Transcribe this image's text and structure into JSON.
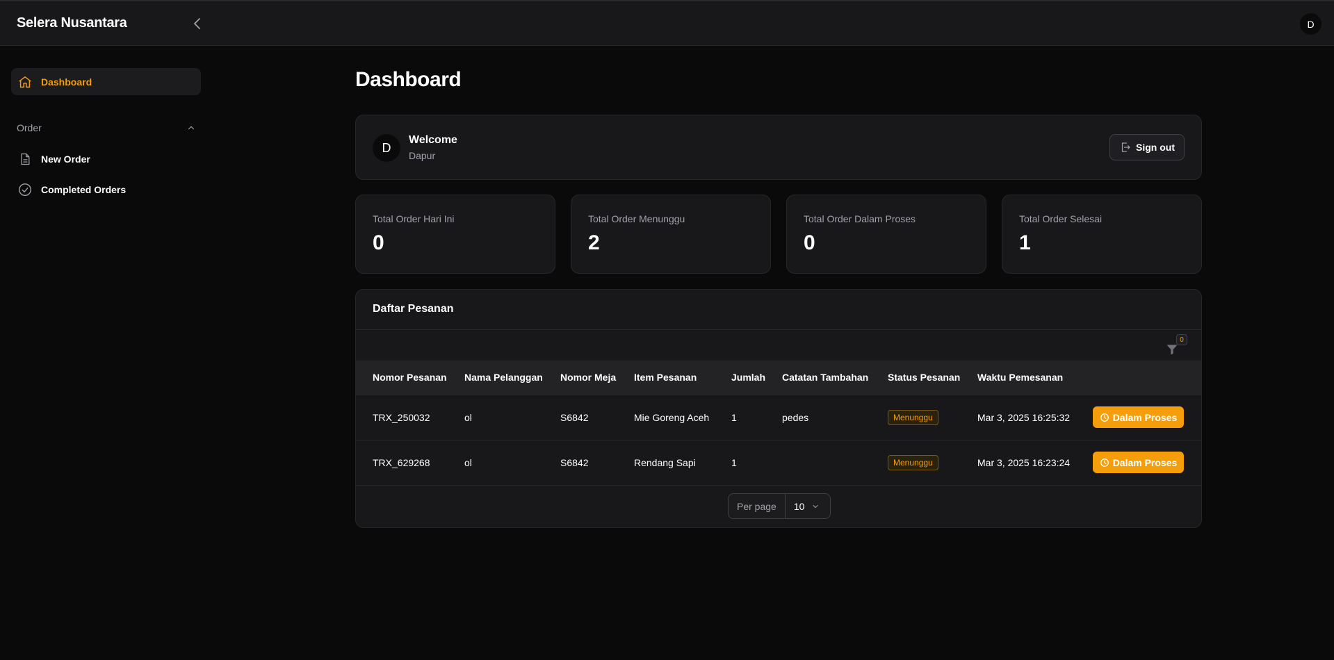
{
  "app": {
    "brand": "Selera Nusantara",
    "user_initial": "D"
  },
  "sidebar": {
    "items": [
      {
        "label": "Dashboard",
        "icon": "home-icon"
      }
    ],
    "section": {
      "label": "Order"
    },
    "order_items": [
      {
        "label": "New Order",
        "icon": "document-icon"
      },
      {
        "label": "Completed Orders",
        "icon": "check-circle-icon"
      }
    ]
  },
  "page": {
    "title": "Dashboard"
  },
  "welcome": {
    "initial": "D",
    "title": "Welcome",
    "subtitle": "Dapur",
    "signout_label": "Sign out"
  },
  "stats": [
    {
      "label": "Total Order Hari Ini",
      "value": "0"
    },
    {
      "label": "Total Order Menunggu",
      "value": "2"
    },
    {
      "label": "Total Order Dalam Proses",
      "value": "0"
    },
    {
      "label": "Total Order Selesai",
      "value": "1"
    }
  ],
  "orders": {
    "title": "Daftar Pesanan",
    "filter_count": "0",
    "columns": [
      "Nomor Pesanan",
      "Nama Pelanggan",
      "Nomor Meja",
      "Item Pesanan",
      "Jumlah",
      "Catatan Tambahan",
      "Status Pesanan",
      "Waktu Pemesanan"
    ],
    "rows": [
      {
        "nomor": "TRX_250032",
        "nama": "ol",
        "meja": "S6842",
        "item": "Mie Goreng Aceh",
        "jumlah": "1",
        "catatan": "pedes",
        "status": "Menunggu",
        "waktu": "Mar 3, 2025 16:25:32",
        "action": "Dalam Proses"
      },
      {
        "nomor": "TRX_629268",
        "nama": "ol",
        "meja": "S6842",
        "item": "Rendang Sapi",
        "jumlah": "1",
        "catatan": "",
        "status": "Menunggu",
        "waktu": "Mar 3, 2025 16:23:24",
        "action": "Dalam Proses"
      }
    ],
    "pagination": {
      "per_page_label": "Per page",
      "per_page_value": "10"
    }
  },
  "colors": {
    "accent": "#f59e0b",
    "background": "#0a0a0b",
    "card": "#18181b"
  }
}
